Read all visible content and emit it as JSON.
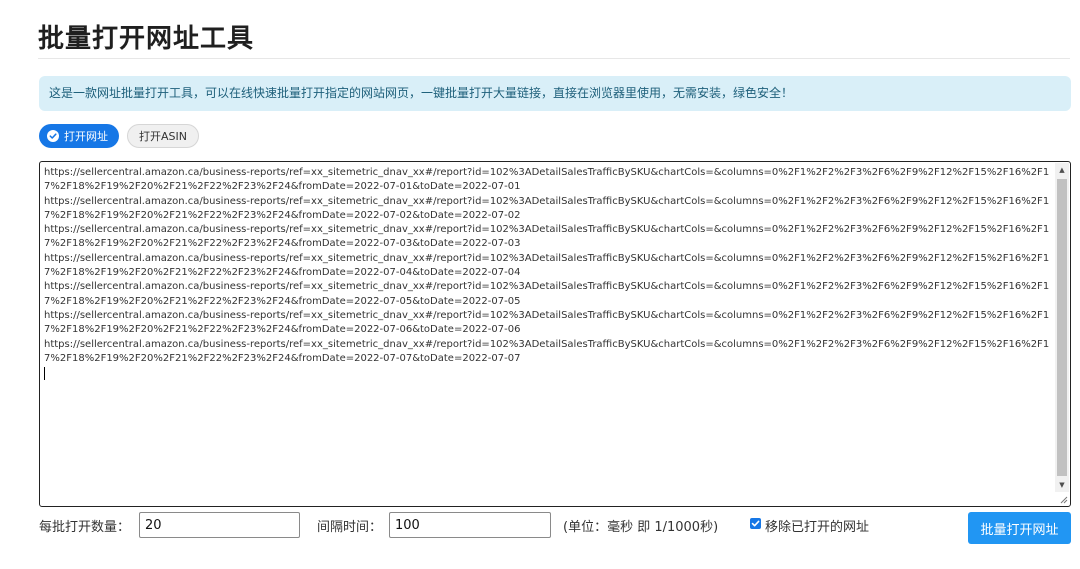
{
  "page": {
    "title": "批量打开网址工具",
    "info": "这是一款网址批量打开工具，可以在线快速批量打开指定的网站网页，一键批量打开大量链接，直接在浏览器里使用，无需安装，绿色安全！"
  },
  "mode_tabs": [
    {
      "label": "打开网址",
      "active": true
    },
    {
      "label": "打开ASIN",
      "active": false
    }
  ],
  "urls": [
    "https://sellercentral.amazon.ca/business-reports/ref=xx_sitemetric_dnav_xx#/report?id=102%3ADetailSalesTrafficBySKU&chartCols=&columns=0%2F1%2F2%2F3%2F6%2F9%2F12%2F15%2F16%2F17%2F18%2F19%2F20%2F21%2F22%2F23%2F24&fromDate=2022-07-01&toDate=2022-07-01",
    "https://sellercentral.amazon.ca/business-reports/ref=xx_sitemetric_dnav_xx#/report?id=102%3ADetailSalesTrafficBySKU&chartCols=&columns=0%2F1%2F2%2F3%2F6%2F9%2F12%2F15%2F16%2F17%2F18%2F19%2F20%2F21%2F22%2F23%2F24&fromDate=2022-07-02&toDate=2022-07-02",
    "https://sellercentral.amazon.ca/business-reports/ref=xx_sitemetric_dnav_xx#/report?id=102%3ADetailSalesTrafficBySKU&chartCols=&columns=0%2F1%2F2%2F3%2F6%2F9%2F12%2F15%2F16%2F17%2F18%2F19%2F20%2F21%2F22%2F23%2F24&fromDate=2022-07-03&toDate=2022-07-03",
    "https://sellercentral.amazon.ca/business-reports/ref=xx_sitemetric_dnav_xx#/report?id=102%3ADetailSalesTrafficBySKU&chartCols=&columns=0%2F1%2F2%2F3%2F6%2F9%2F12%2F15%2F16%2F17%2F18%2F19%2F20%2F21%2F22%2F23%2F24&fromDate=2022-07-04&toDate=2022-07-04",
    "https://sellercentral.amazon.ca/business-reports/ref=xx_sitemetric_dnav_xx#/report?id=102%3ADetailSalesTrafficBySKU&chartCols=&columns=0%2F1%2F2%2F3%2F6%2F9%2F12%2F15%2F16%2F17%2F18%2F19%2F20%2F21%2F22%2F23%2F24&fromDate=2022-07-05&toDate=2022-07-05",
    "https://sellercentral.amazon.ca/business-reports/ref=xx_sitemetric_dnav_xx#/report?id=102%3ADetailSalesTrafficBySKU&chartCols=&columns=0%2F1%2F2%2F3%2F6%2F9%2F12%2F15%2F16%2F17%2F18%2F19%2F20%2F21%2F22%2F23%2F24&fromDate=2022-07-06&toDate=2022-07-06",
    "https://sellercentral.amazon.ca/business-reports/ref=xx_sitemetric_dnav_xx#/report?id=102%3ADetailSalesTrafficBySKU&chartCols=&columns=0%2F1%2F2%2F3%2F6%2F9%2F12%2F15%2F16%2F17%2F18%2F19%2F20%2F21%2F22%2F23%2F24&fromDate=2022-07-07&toDate=2022-07-07"
  ],
  "controls": {
    "batch_label": "每批打开数量：",
    "batch_value": "20",
    "interval_label": "间隔时间：",
    "interval_value": "100",
    "unit_text": "(单位：毫秒 即 1/1000秒)",
    "remove_opened_label": "移除已打开的网址",
    "remove_opened_checked": true,
    "open_button": "批量打开网址"
  },
  "colors": {
    "primary": "#1677e6",
    "button": "#2196f3",
    "info_bg": "#d9eff8"
  }
}
